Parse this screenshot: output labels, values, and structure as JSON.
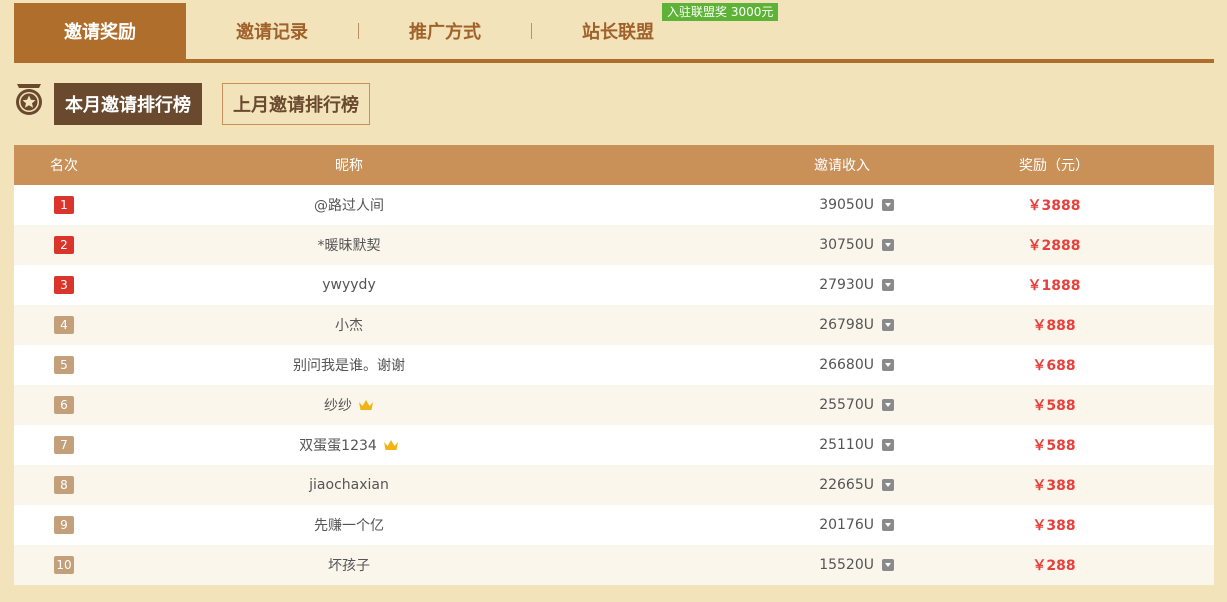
{
  "tabs": [
    {
      "label": "邀请奖励",
      "active": true
    },
    {
      "label": "邀请记录",
      "active": false
    },
    {
      "label": "推广方式",
      "active": false
    },
    {
      "label": "站长联盟",
      "active": false
    }
  ],
  "promo_badge": "入驻联盟奖 3000元",
  "subtabs": {
    "current": "本月邀请排行榜",
    "previous": "上月邀请排行榜"
  },
  "table": {
    "headers": {
      "rank": "名次",
      "nickname": "昵称",
      "income": "邀请收入",
      "reward": "奖励（元）"
    },
    "rows": [
      {
        "rank": "1",
        "name": "@路过人间",
        "income": "39050U",
        "reward": "￥3888",
        "crown": false
      },
      {
        "rank": "2",
        "name": "*暖昧默契",
        "income": "30750U",
        "reward": "￥2888",
        "crown": false
      },
      {
        "rank": "3",
        "name": "ywyydy",
        "income": "27930U",
        "reward": "￥1888",
        "crown": false
      },
      {
        "rank": "4",
        "name": "小杰",
        "income": "26798U",
        "reward": "￥888",
        "crown": false
      },
      {
        "rank": "5",
        "name": "别问我是谁。谢谢",
        "income": "26680U",
        "reward": "￥688",
        "crown": false
      },
      {
        "rank": "6",
        "name": "纱纱",
        "income": "25570U",
        "reward": "￥588",
        "crown": true
      },
      {
        "rank": "7",
        "name": "双蛋蛋1234",
        "income": "25110U",
        "reward": "￥588",
        "crown": true
      },
      {
        "rank": "8",
        "name": "jiaochaxian",
        "income": "22665U",
        "reward": "￥388",
        "crown": false
      },
      {
        "rank": "9",
        "name": "先赚一个亿",
        "income": "20176U",
        "reward": "￥388",
        "crown": false
      },
      {
        "rank": "10",
        "name": "坏孩子",
        "income": "15520U",
        "reward": "￥288",
        "crown": false
      }
    ]
  },
  "colors": {
    "background": "#f2e3bb",
    "accent": "#b06e2c",
    "header": "#c99058",
    "top_rank": "#d9352b",
    "other_rank": "#c4a07a",
    "reward": "#e8403a",
    "promo": "#5cb335"
  }
}
